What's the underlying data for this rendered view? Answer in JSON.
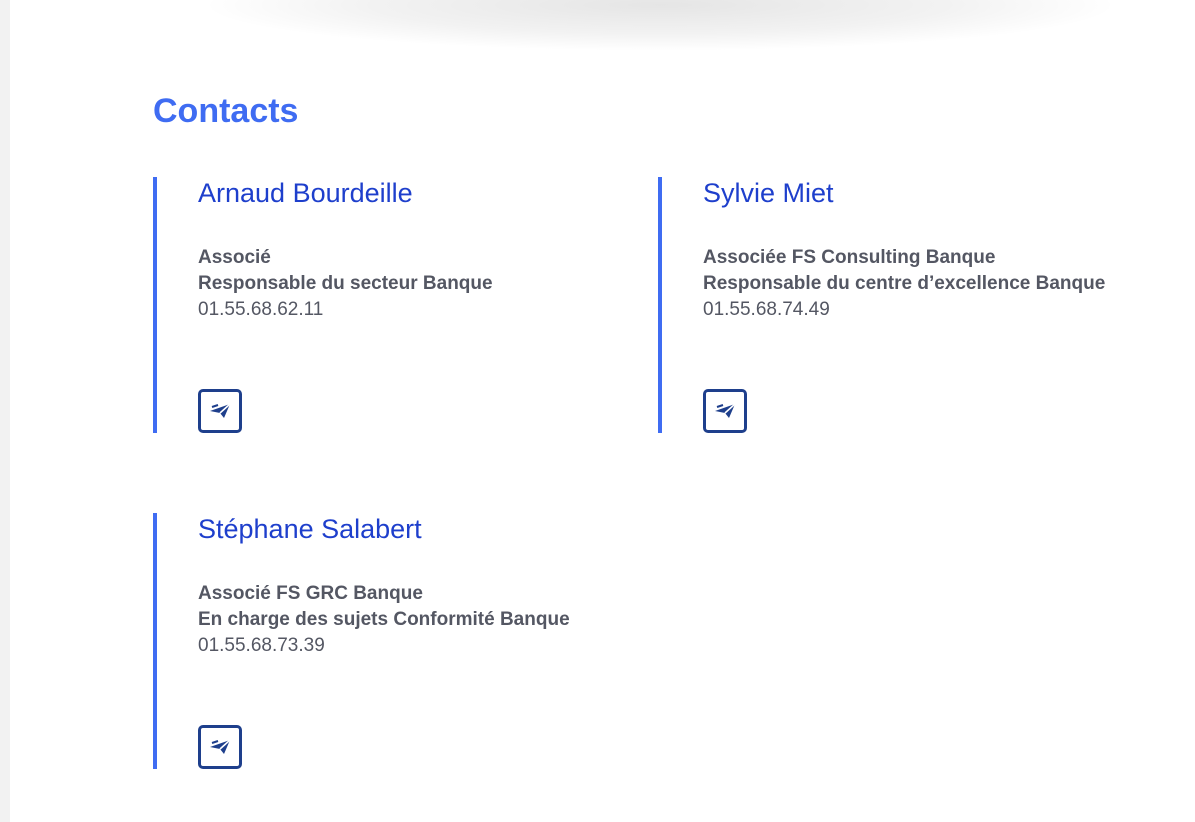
{
  "section": {
    "title": "Contacts"
  },
  "contacts": [
    {
      "name": "Arnaud Bourdeille",
      "roles": [
        "Associé",
        "Responsable du secteur Banque"
      ],
      "phone": "01.55.68.62.11",
      "icon": "send-icon"
    },
    {
      "name": "Sylvie Miet",
      "roles": [
        "Associée FS Consulting Banque",
        "Responsable du centre d’excellence Banque"
      ],
      "phone": "01.55.68.74.49",
      "icon": "send-icon"
    },
    {
      "name": "Stéphane Salabert",
      "roles": [
        "Associé FS GRC Banque",
        "En charge des sujets Conformité Banque"
      ],
      "phone": "01.55.68.73.39",
      "icon": "send-icon"
    }
  ],
  "colors": {
    "accent": "#3f6cf2",
    "name": "#1e3fcc",
    "text": "#545763",
    "icon": "#1e3f8c"
  }
}
